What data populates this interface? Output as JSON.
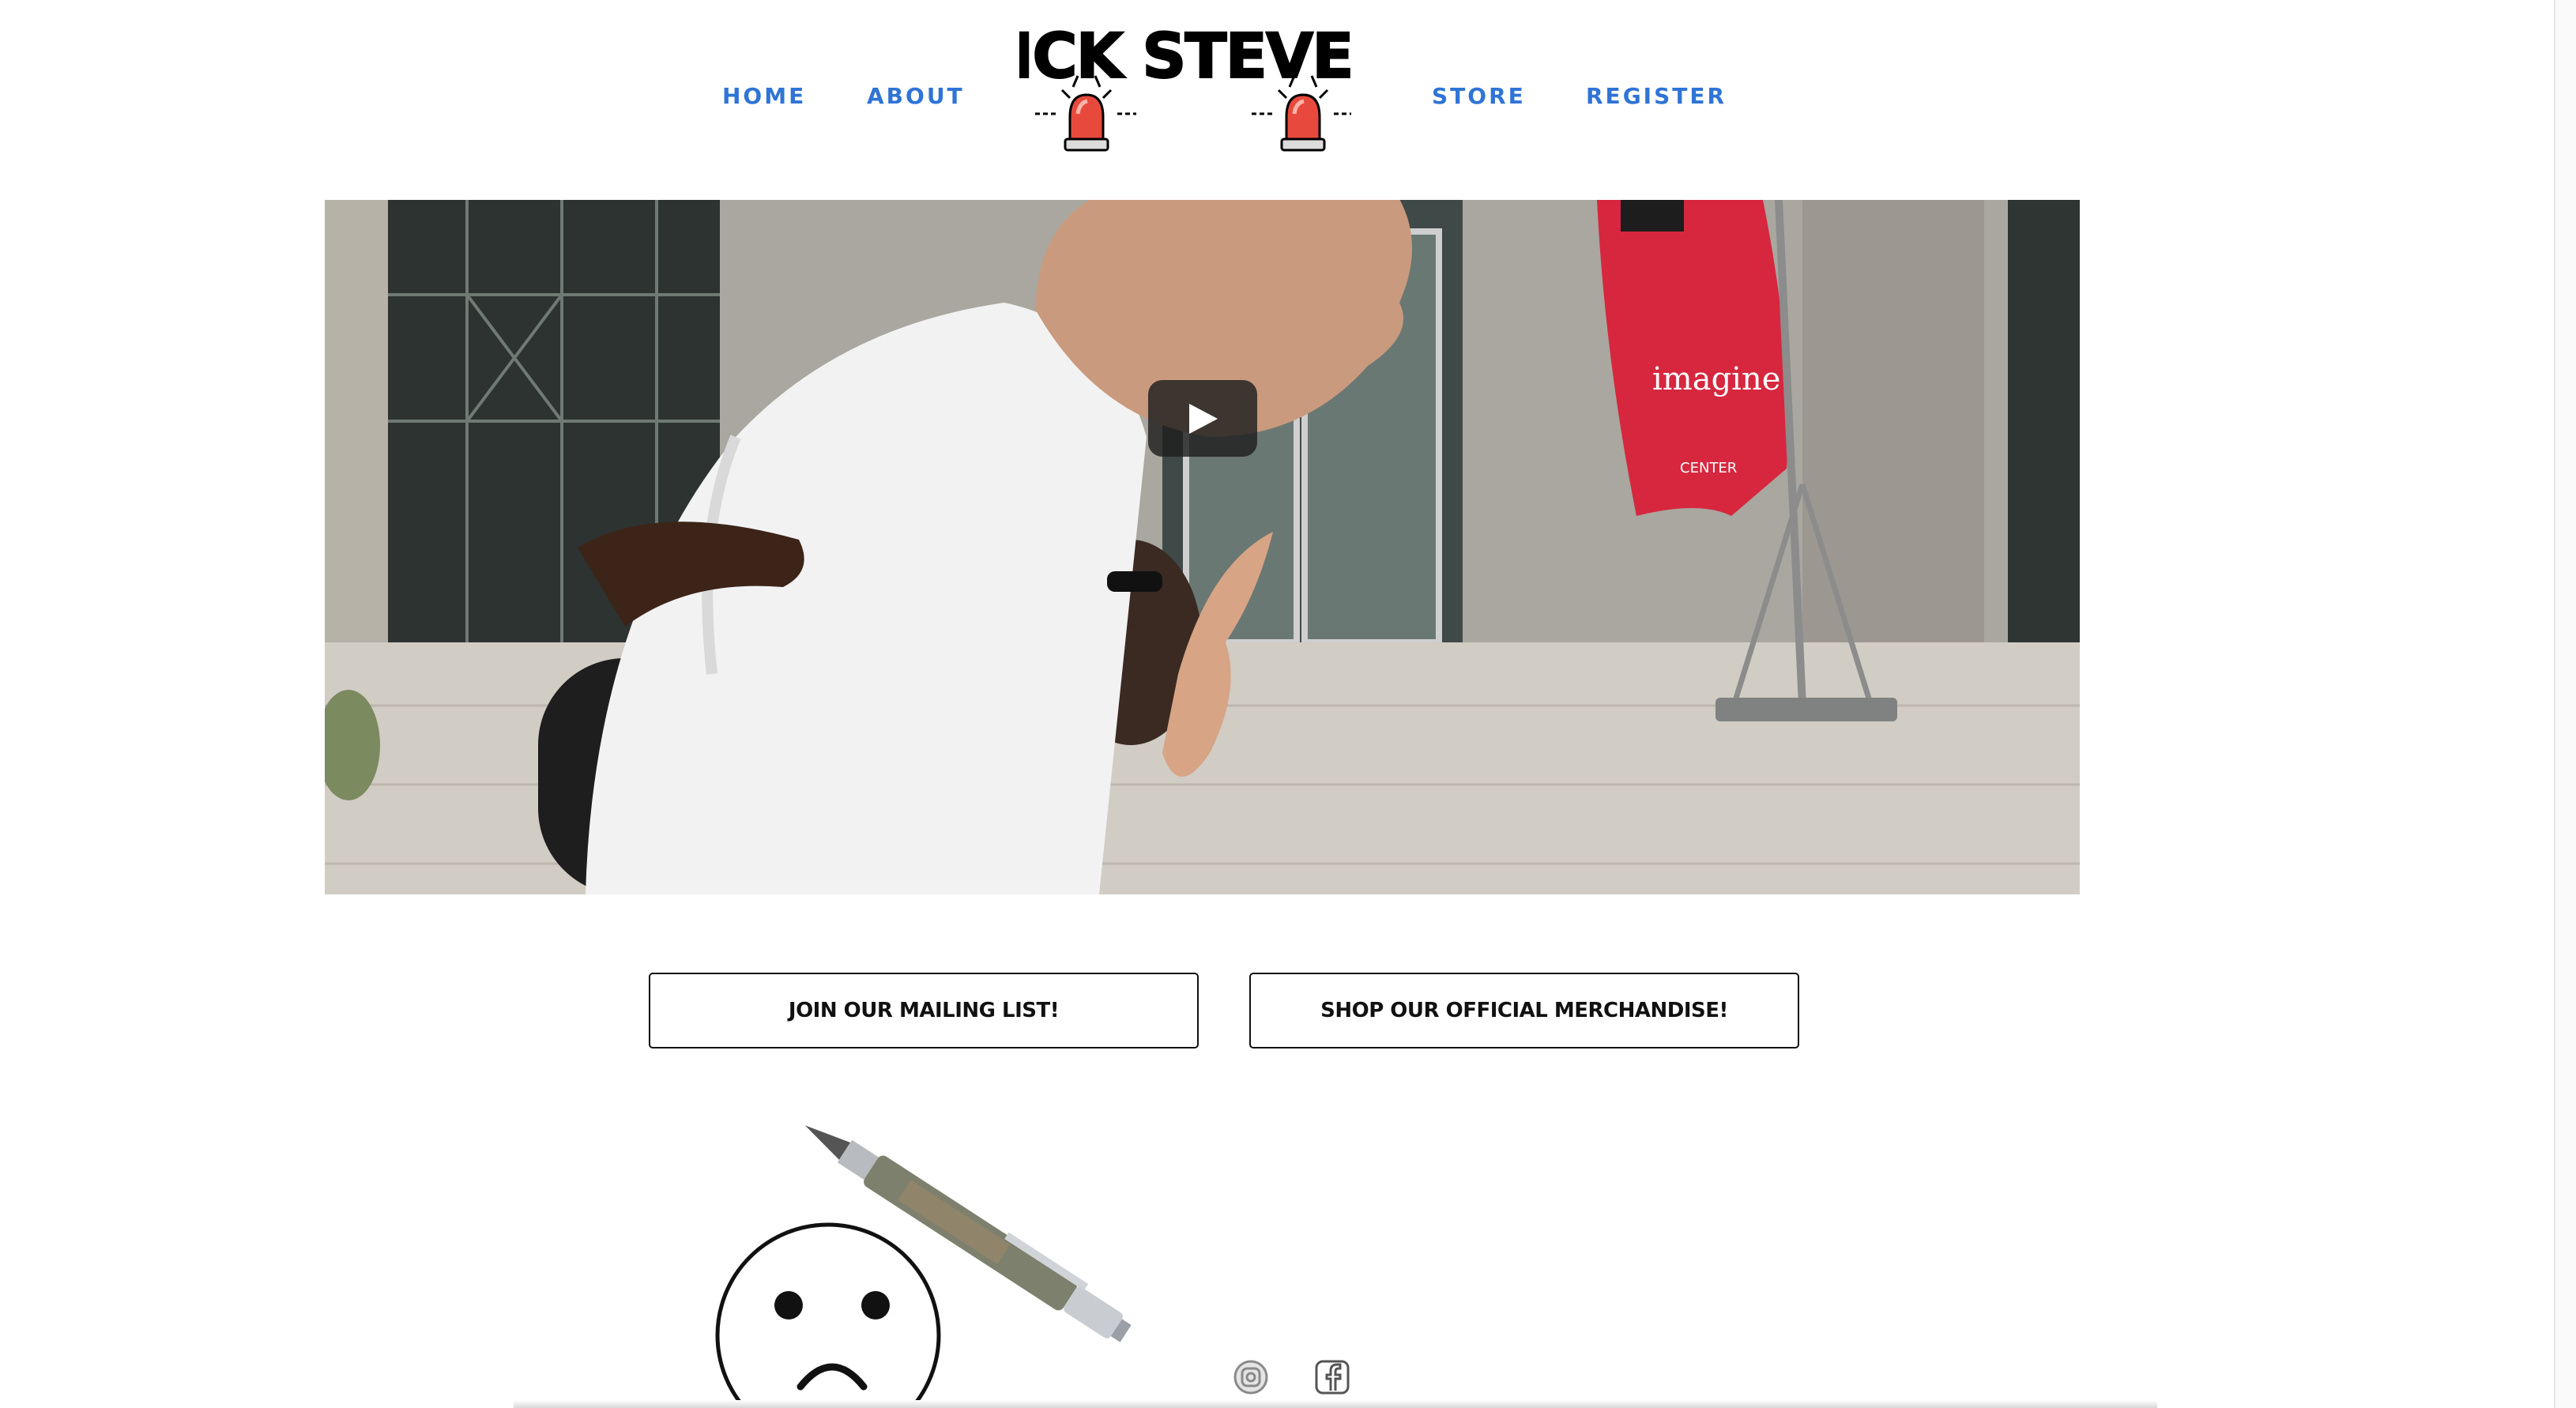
{
  "nav": {
    "home": "HOME",
    "about": "ABOUT",
    "store": "STORE",
    "register": "REGISTER"
  },
  "logo": {
    "text": "SICK STEVEN",
    "icon": "siren-icon"
  },
  "video": {
    "play_icon": "play-icon",
    "flag_text": "imagine",
    "flag_subtext": "CENTER"
  },
  "cta": {
    "mailing_list": "JOIN OUR MAILING LIST!",
    "merch": "SHOP OUR OFFICIAL MERCHANDISE!"
  },
  "social": {
    "instagram_icon": "instagram-icon",
    "facebook_icon": "facebook-icon"
  },
  "colors": {
    "nav_link": "#2f74d6",
    "siren": "#e8493d",
    "text": "#111111"
  }
}
